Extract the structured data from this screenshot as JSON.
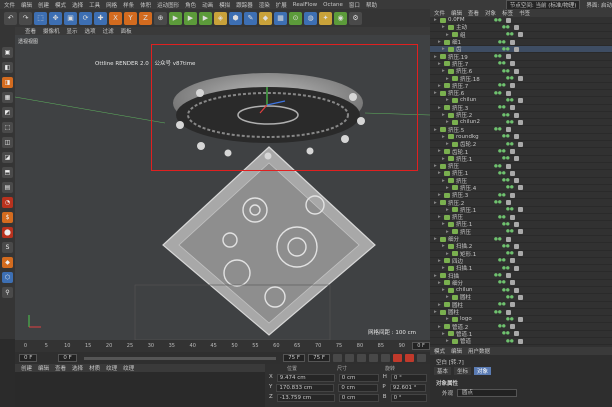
{
  "app": {
    "menu": [
      "文件",
      "编辑",
      "创建",
      "模式",
      "选择",
      "工具",
      "网格",
      "样条",
      "体积",
      "运动图形",
      "角色",
      "动画",
      "模拟",
      "跟踪器",
      "渲染",
      "扩展",
      "RealFlow",
      "Octane",
      "窗口",
      "帮助"
    ],
    "node_space_label": "节点空间:",
    "node_space_value": "当前 (标准/物理)",
    "interface_label": "界面:",
    "interface_value": "启动"
  },
  "toolbar": {
    "buttons": [
      "↶",
      "↷",
      "⬚",
      "✥",
      "▣",
      "⟳",
      "✚",
      "X",
      "Y",
      "Z",
      "⊕",
      "▶",
      "▶",
      "▶",
      "◈",
      "⬢",
      "✎",
      "◆",
      "▦",
      "⊙",
      "◍",
      "✦",
      "◉",
      "⚙"
    ]
  },
  "leftbar": {
    "buttons": [
      "▣",
      "◧",
      "◨",
      "▦",
      "◩",
      "⬚",
      "◫",
      "◪",
      "⬒",
      "▤",
      "◔",
      "$",
      "⬤",
      "S",
      "◆",
      "⬡",
      "⚲"
    ]
  },
  "viewport": {
    "menu": [
      "查看",
      "摄像机",
      "显示",
      "选项",
      "过滤",
      "面板"
    ],
    "label": "透视视图",
    "octane_label": "Ottline RENDER 2.0",
    "octane_sub": "公众号 v87time",
    "grid_label": "网格间距 : 100 cm"
  },
  "timeline": {
    "ticks": [
      "0",
      "5",
      "10",
      "15",
      "20",
      "25",
      "30",
      "35",
      "40",
      "45",
      "50",
      "55",
      "60",
      "65",
      "70",
      "75",
      "80",
      "85",
      "90"
    ],
    "end": "0 F"
  },
  "playbar": {
    "current": "0 F",
    "start": "0 F",
    "end": "75 F",
    "end2": "75 F"
  },
  "material": {
    "menu": [
      "创建",
      "编辑",
      "查看",
      "选择",
      "材质",
      "纹理",
      "纹理"
    ]
  },
  "coords": {
    "headers": [
      "位置",
      "尺寸",
      "旋转"
    ],
    "rows": [
      {
        "axis": "X",
        "pos": "9.474 cm",
        "size": "0 cm",
        "rot_axis": "H",
        "rot": "0 °"
      },
      {
        "axis": "Y",
        "pos": "170.833 cm",
        "size": "0 cm",
        "rot_axis": "P",
        "rot": "92.601 °"
      },
      {
        "axis": "Z",
        "pos": "-13.759 cm",
        "size": "0 cm",
        "rot_axis": "B",
        "rot": "0 °"
      }
    ]
  },
  "objects": {
    "menu": [
      "文件",
      "编辑",
      "查看",
      "对象",
      "标签",
      "书签"
    ],
    "rows": [
      {
        "name": "0.0FM",
        "sel": false
      },
      {
        "name": "主动",
        "sel": false
      },
      {
        "name": "组",
        "sel": false
      },
      {
        "name": "细1",
        "sel": false
      },
      {
        "name": "齿",
        "sel": true
      },
      {
        "name": "挤压.19",
        "sel": false
      },
      {
        "name": "挤压.7",
        "sel": false
      },
      {
        "name": "挤压.6",
        "sel": false
      },
      {
        "name": "挤压.18",
        "sel": false
      },
      {
        "name": "挤压.7",
        "sel": false
      },
      {
        "name": "挤压.6",
        "sel": false
      },
      {
        "name": "chilun",
        "sel": false
      },
      {
        "name": "挤压.3",
        "sel": false
      },
      {
        "name": "挤压.2",
        "sel": false
      },
      {
        "name": "chilun2",
        "sel": false
      },
      {
        "name": "挤压.5",
        "sel": false
      },
      {
        "name": "roundkg",
        "sel": false
      },
      {
        "name": "齿轮.2",
        "sel": false
      },
      {
        "name": "齿轮.1",
        "sel": false
      },
      {
        "name": "挤压.1",
        "sel": false
      },
      {
        "name": "挤压",
        "sel": false
      },
      {
        "name": "挤压.1",
        "sel": false
      },
      {
        "name": "挤压",
        "sel": false
      },
      {
        "name": "挤压.4",
        "sel": false
      },
      {
        "name": "挤压.3",
        "sel": false
      },
      {
        "name": "挤压.2",
        "sel": false
      },
      {
        "name": "挤压.1",
        "sel": false
      },
      {
        "name": "挤压",
        "sel": false
      },
      {
        "name": "挤压.1",
        "sel": false
      },
      {
        "name": "挤压",
        "sel": false
      },
      {
        "name": "细分",
        "sel": false
      },
      {
        "name": "扫描.2",
        "sel": false
      },
      {
        "name": "矩形.1",
        "sel": false
      },
      {
        "name": "四边",
        "sel": false
      },
      {
        "name": "扫描.1",
        "sel": false
      },
      {
        "name": "扫描",
        "sel": false
      },
      {
        "name": "细分",
        "sel": false
      },
      {
        "name": "chilun",
        "sel": false
      },
      {
        "name": "圆柱",
        "sel": false
      },
      {
        "name": "圆柱",
        "sel": false
      },
      {
        "name": "圆柱",
        "sel": false
      },
      {
        "name": "logo",
        "sel": false
      },
      {
        "name": "管道.2",
        "sel": false
      },
      {
        "name": "管道.1",
        "sel": false
      },
      {
        "name": "管道",
        "sel": false
      }
    ]
  },
  "attributes": {
    "menu": [
      "模式",
      "编辑",
      "用户数据"
    ],
    "title": "空白 [转.7]",
    "tabs": [
      "基本",
      "坐标",
      "对象"
    ],
    "section": "对象属性",
    "row_label": "外观",
    "row_value": "圆点"
  }
}
